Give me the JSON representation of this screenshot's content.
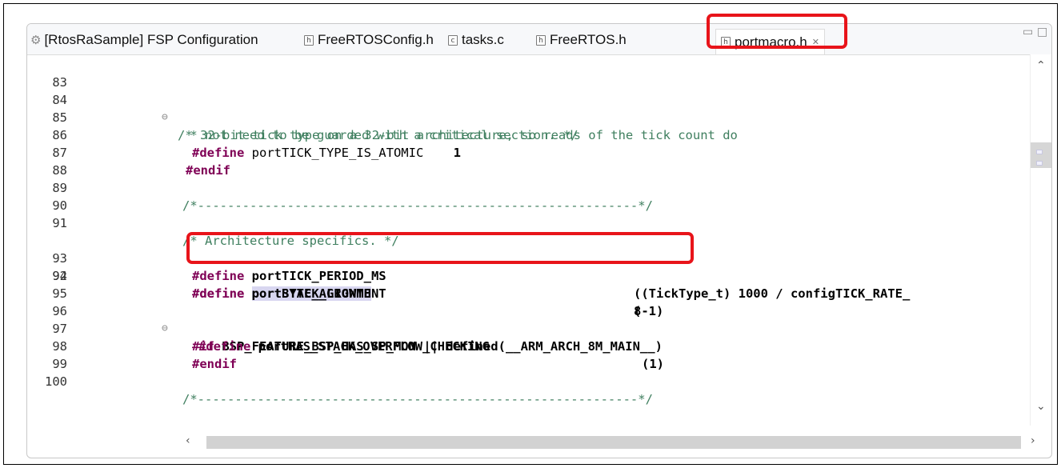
{
  "tabs": [
    {
      "label": "[RtosRaSample] FSP Configuration",
      "icon": "gear-icon"
    },
    {
      "label": "FreeRTOSConfig.h",
      "icon": "h-file-icon"
    },
    {
      "label": "tasks.c",
      "icon": "c-file-icon"
    },
    {
      "label": "FreeRTOS.h",
      "icon": "h-file-icon"
    },
    {
      "label": "portmacro.h",
      "icon": "h-file-icon",
      "active": true
    }
  ],
  "lines": [
    {
      "n": "83"
    },
    {
      "n": "84",
      "t1": "/* 32-bit tick type on a 32-bit architecture, so reads of the tick count do"
    },
    {
      "n": "85",
      "t1": " * not need to be guarded with a critical section. */"
    },
    {
      "n": "86",
      "kw": "#define",
      "t1": " portTICK_TYPE_IS_ATOMIC",
      "t2": "    1"
    },
    {
      "n": "87",
      "kw": "#endif"
    },
    {
      "n": "88"
    },
    {
      "n": "89",
      "t1": "/*-----------------------------------------------------------*/"
    },
    {
      "n": "90"
    },
    {
      "n": "91",
      "t1": "/* Architecture specifics. */"
    },
    {
      "n": "92",
      "kw": "#define",
      "t1": "portSTACK_GROWTH",
      "t2": "(-1)"
    },
    {
      "n": "93",
      "kw": "#define",
      "t1": " portTICK_PERIOD_MS",
      "t2": "((TickType_t) 1000 / configTICK_RATE_"
    },
    {
      "n": "94",
      "kw": "#define",
      "t1": " portBYTE_ALIGNMENT",
      "t2": "8"
    },
    {
      "n": "95"
    },
    {
      "n": "96",
      "kw": "#if",
      "t1": " BSP_FEATURE_BSP_HAS_SP_MON || defined(__ARM_ARCH_8M_MAIN__)"
    },
    {
      "n": "97",
      "kw": "#define",
      "t1": " portHAS_STACK_OVERFLOW_CHECKING",
      "t2": "(1)"
    },
    {
      "n": "98",
      "kw": "#endif"
    },
    {
      "n": "99"
    },
    {
      "n": "100",
      "t1": "/*-----------------------------------------------------------*/"
    }
  ],
  "colors": {
    "highlight": "#e8141a",
    "keyword": "#7f0055",
    "comment": "#3f7f5f"
  }
}
